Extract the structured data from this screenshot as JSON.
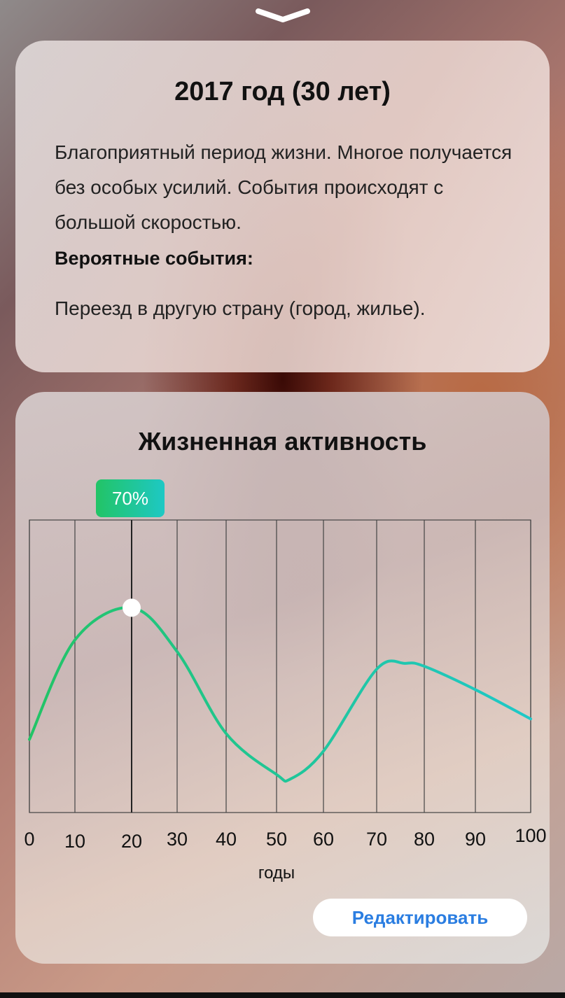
{
  "top": {
    "collapse_icon": "chevron-down-icon"
  },
  "year_card": {
    "title": "2017 год (30 лет)",
    "description": "Благоприятный период жизни. Многое получается без особых усилий. События происходят с большой скоростью.",
    "events_heading": "Вероятные события:",
    "events_text": "Переезд в другую страну (город, жилье)."
  },
  "activity_card": {
    "title": "Жизненная активность",
    "edit_label": "Редактировать"
  },
  "chart_data": {
    "type": "line",
    "title": "Жизненная активность",
    "xlabel": "годы",
    "ylabel": "",
    "x_ticks": [
      "0",
      "10",
      "20",
      "30",
      "40",
      "50",
      "60",
      "70",
      "80",
      "90",
      "100"
    ],
    "xlim": [
      0,
      100
    ],
    "ylim": [
      0,
      100
    ],
    "grid": "vertical",
    "series": [
      {
        "x": [
          0,
          10,
          20,
          30,
          40,
          50,
          53,
          60,
          70,
          76,
          80,
          90,
          100
        ],
        "y": [
          25,
          59,
          70,
          55,
          27,
          13,
          11.5,
          21,
          49,
          51,
          50,
          42,
          32
        ]
      }
    ],
    "marker": {
      "x": 20,
      "y": 70,
      "label": "70%"
    },
    "colors": {
      "line_start": "#22c466",
      "line_end": "#1ec8c8",
      "grid": "#333333"
    }
  }
}
